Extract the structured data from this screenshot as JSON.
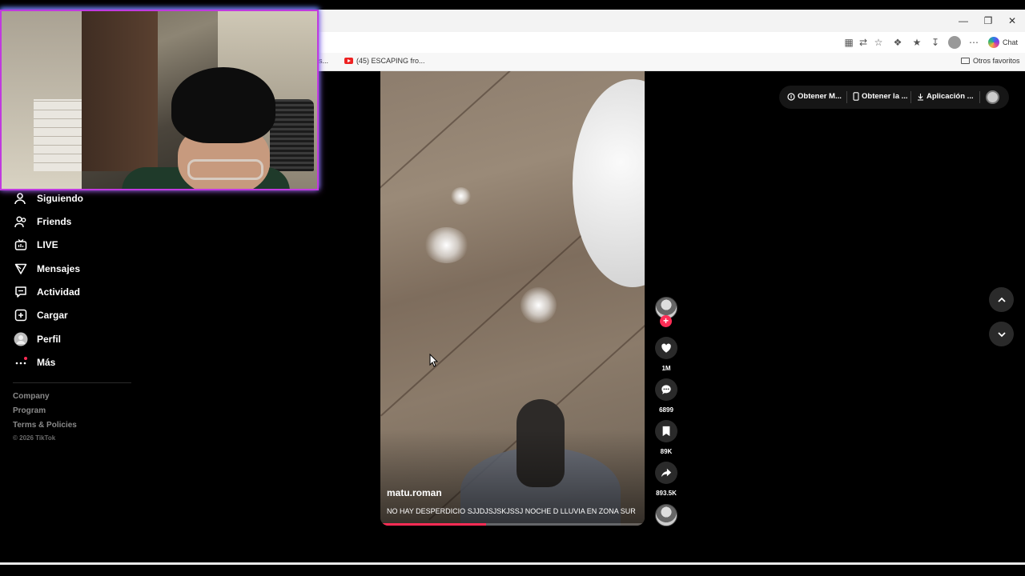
{
  "browser": {
    "toolbar_icons": [
      "apps-icon",
      "translate-icon",
      "star-icon",
      "extensions-icon",
      "favorites-icon",
      "download-icon",
      "profile-icon",
      "more-icon"
    ],
    "copilot_label": "Chat",
    "bookmarks": [
      {
        "label": "s...",
        "icon": "none"
      },
      {
        "label": "(45) ESCAPING fro...",
        "icon": "youtube-icon"
      }
    ],
    "other_favorites": "Otros favoritos"
  },
  "sidebar": {
    "items": [
      {
        "label": "Siguiendo",
        "icon": "following-icon"
      },
      {
        "label": "Friends",
        "icon": "friends-icon"
      },
      {
        "label": "LIVE",
        "icon": "live-icon"
      },
      {
        "label": "Mensajes",
        "icon": "messages-icon"
      },
      {
        "label": "Actividad",
        "icon": "activity-icon"
      },
      {
        "label": "Cargar",
        "icon": "upload-icon"
      },
      {
        "label": "Perfil",
        "icon": "profile-icon"
      },
      {
        "label": "Más",
        "icon": "more-icon"
      }
    ],
    "footer": {
      "links": [
        "Company",
        "Program",
        "Terms & Policies"
      ],
      "copyright": "© 2026 TikTok"
    }
  },
  "top_menu": {
    "items": [
      {
        "label": "Obtener M...",
        "icon": "coin-icon"
      },
      {
        "label": "Obtener la ...",
        "icon": "phone-icon"
      },
      {
        "label": "Aplicación ...",
        "icon": "download-icon"
      }
    ]
  },
  "video": {
    "author": "matu.roman",
    "caption": "NO HAY DESPERDICIO SJJDJSJSKJSSJ NOCHE D LLUVIA EN ZONA SUR",
    "progress": 0.4
  },
  "actions": {
    "likes": "1M",
    "comments": "6899",
    "saves": "89K",
    "shares": "893.5K"
  }
}
